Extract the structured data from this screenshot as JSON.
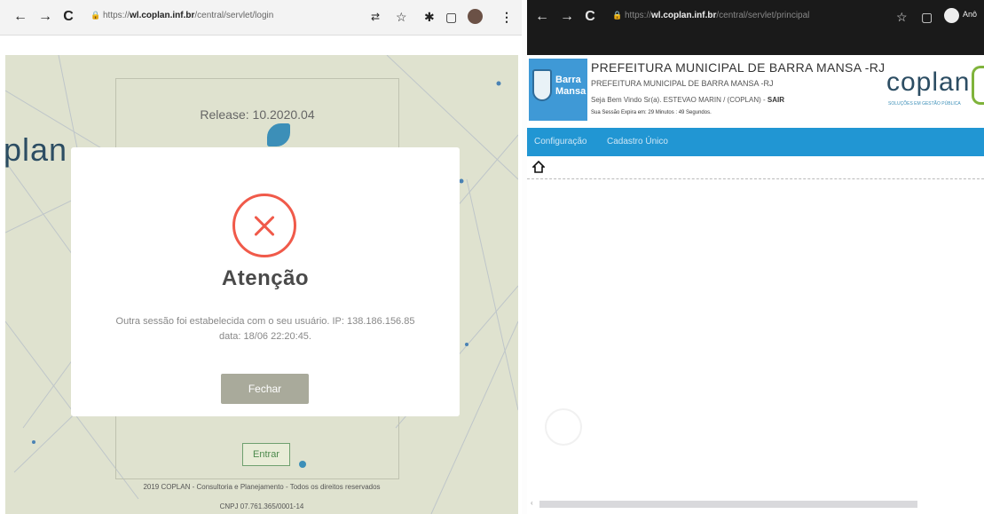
{
  "left_window": {
    "url_host": "wl.coplan.inf.br",
    "url_path": "/central/servlet/login",
    "url_scheme": "https://",
    "login": {
      "release": "Release: 10.2020.04",
      "brand": "plan",
      "entrar": "Entrar",
      "footer_line1": "2019 COPLAN - Consultoria e Planejamento - Todos os direitos reservados",
      "footer_line2": "CNPJ 07.761.365/0001-14"
    },
    "modal": {
      "title": "Atenção",
      "message": "Outra sessão foi estabelecida com o seu usuário. IP: 138.186.156.85 data: 18/06 22:20:45.",
      "close_label": "Fechar",
      "accent_color": "#f05a4a"
    }
  },
  "right_window": {
    "url_host": "wl.coplan.inf.br",
    "url_path": "/central/servlet/principal",
    "url_scheme": "https://",
    "profile_label": "Anô",
    "header": {
      "logo_text_1": "Barra",
      "logo_text_2": "Mansa",
      "title": "PREFEITURA MUNICIPAL DE BARRA MANSA -RJ",
      "subtitle": "PREFEITURA MUNICIPAL DE BARRA MANSA -RJ",
      "welcome": "Seja Bem Vindo Sr(a). ESTEVAO MARIN / (COPLAN)",
      "sair": "SAIR",
      "session": "Sua Sessão Expira em: 29 Minutos : 49 Segundos.",
      "brand": "coplan",
      "brand_sub": "SOLUÇÕES EM GESTÃO PÚBLICA"
    },
    "menu": [
      "Configuração",
      "Cadastro Único"
    ],
    "menu_color": "#2196d3"
  }
}
